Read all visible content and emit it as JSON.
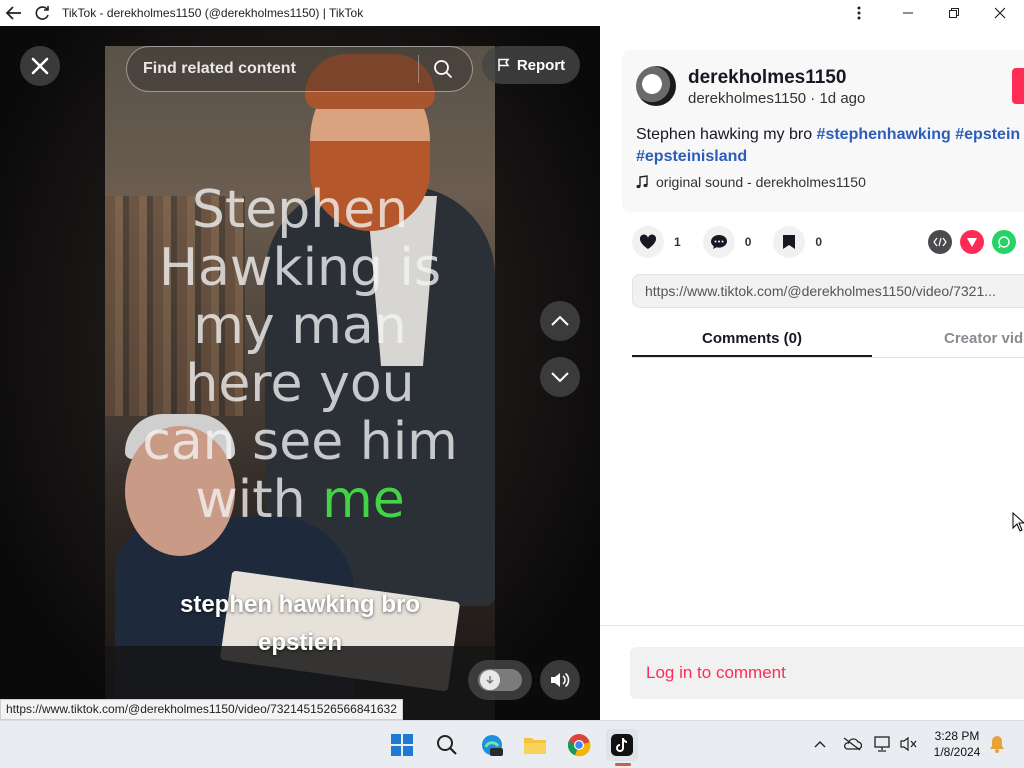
{
  "window": {
    "title": "TikTok - derekholmes1150 (@derekholmes1150) | TikTok"
  },
  "video": {
    "overlay_lines": [
      "Stephen",
      "Hawking is",
      "my man",
      "here you",
      "can see him",
      "with"
    ],
    "overlay_highlight": "me",
    "caption_lines": [
      "stephen hawking bro",
      "epstien"
    ],
    "search_placeholder": "Find related content",
    "report_label": "Report",
    "hover_url": "https://www.tiktok.com/@derekholmes1150/video/7321451526566841632"
  },
  "post": {
    "username": "derekholmes1150",
    "subline": "derekholmes1150 · 1d ago",
    "description_text": "Stephen hawking my bro ",
    "hashtags_line1": [
      "#stephenhawking",
      "#epstein"
    ],
    "hashtags_line2": [
      "#epsteinisland"
    ],
    "music": "original sound - derekholmes1150",
    "likes": "1",
    "comments": "0",
    "saves": "0",
    "link": "https://www.tiktok.com/@derekholmes1150/video/7321..."
  },
  "tabs": {
    "comments": "Comments (0)",
    "creator": "Creator videos"
  },
  "login_prompt": "Log in to comment",
  "taskbar": {
    "time": "3:28 PM",
    "date": "1/8/2024"
  },
  "colors": {
    "accent": "#fe2c55",
    "hashtag": "#2b5db9",
    "highlight": "#42d444"
  }
}
